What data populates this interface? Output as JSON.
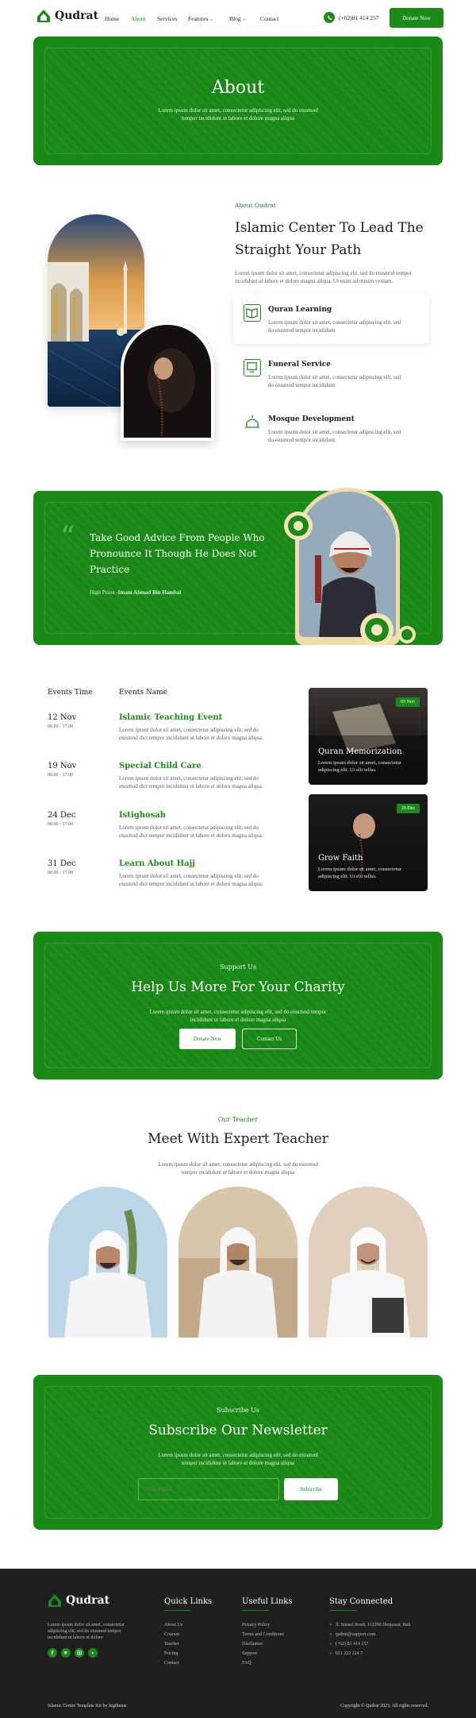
{
  "nav": {
    "brand": "Qudrat",
    "items": [
      "Home",
      "About",
      "Services",
      "Features",
      "Blog",
      "Contact"
    ],
    "phone": "(+62)81 414 257",
    "donate": "Donate Now"
  },
  "hero": {
    "title": "About",
    "desc1": "Lorem ipsum dolor sit amet, consectetur adipiscing elit, sed do eiusmod",
    "desc2": "tempor incididunt ut labore et dolore magna aliqua"
  },
  "about": {
    "eyebrow": "About Qudrat",
    "title1": "Islamic Center To Lead The",
    "title2": "Straight Your Path",
    "desc1": "Lorem ipsum dolor sit amet, consectetur adipiscing elit, sed do eiusmod tempor",
    "desc2": "incididunt ut labore et dolore magna aliqua. Ut enim ad minim veniam.",
    "features": [
      {
        "title": "Quran Learning",
        "icon": "book-icon",
        "d1": "Lorem ipsum dolor sit amet, consectetur adipiscing elit, sed",
        "d2": "do eiusmod tempor incididunt."
      },
      {
        "title": "Funeral Service",
        "icon": "funeral-icon",
        "d1": "Lorem ipsum dolor sit amet, consectetur adipiscing elit, sed",
        "d2": "do eiusmod tempor incididunt."
      },
      {
        "title": "Mosque Development",
        "icon": "mosque-icon",
        "d1": "Lorem ipsum dolor sit amet, consectetur adipiscing elit, sed",
        "d2": "do eiusmod tempor incididunt."
      }
    ]
  },
  "quote": {
    "line1": "Take Good Advice From People Who",
    "line2": "Pronounce It Though He Does Not",
    "line3": "Practice",
    "author_prefix": "High Priest -",
    "author": "Imam Ahmad Bin Hambal"
  },
  "events": {
    "col_time": "Events Time",
    "col_name": "Events Name",
    "rows": [
      {
        "date": "12 Nov",
        "time": "08.00 - 17.00",
        "title": "Islamic Teaching Event",
        "d1": "Lorem ipsum dolor sit amet, consectetur adipiscing elit, sed do",
        "d2": "eiusmod dict tempor incididunt ut labore et dolore magna aliqua."
      },
      {
        "date": "19 Nov",
        "time": "08.00 - 17.00",
        "title": "Special Child Care",
        "d1": "Lorem ipsum dolor sit amet, consectetur adipiscing elit, sed do",
        "d2": "eiusmod dict tempor incididunt ut labore et dolore magna aliqua."
      },
      {
        "date": "24 Dec",
        "time": "08.00 - 17.00",
        "title": "Istighosah",
        "d1": "Lorem ipsum dolor sit amet, consectetur adipiscing elit, sed do",
        "d2": "eiusmod dict tempor incididunt ut labore et dolore magna aliqua."
      },
      {
        "date": "31 Dec",
        "time": "08.00 - 17.00",
        "title": "Learn About Hajj",
        "d1": "Lorem ipsum dolor sit amet, consectetur adipiscing elit, sed do",
        "d2": "eiusmod dict tempor incididunt ut labore et dolore magna aliqua."
      }
    ],
    "cards": [
      {
        "badge": "05 Nov",
        "title": "Quran Memorization",
        "d1": "Lorem ipsum dolor sit amet, consectetur",
        "d2": "adipiscing elit. Ut elit tellus."
      },
      {
        "badge": "20 Dec",
        "title": "Grow Faith",
        "d1": "Lorem ipsum dolor sit amet, consectetur",
        "d2": "adipiscing elit. Ut elit tellus."
      }
    ]
  },
  "charity": {
    "eyebrow": "Support Us",
    "title": "Help Us More For Your Charity",
    "desc1": "Lorem ipsum dolor sit amet, consectetur adipiscing elit, sed do eiusmod tempor",
    "desc2": "incididunt ut labore et dolore magna aliqua",
    "btn1": "Donate Now",
    "btn2": "Contact Us"
  },
  "teacher": {
    "eyebrow": "Our Teacher",
    "title": "Meet With Expert Teacher",
    "desc1": "Lorem ipsum dolor sit amet, consectetur adipiscing elit, sed do eiusmod",
    "desc2": "tempor incididunt ut labore et dolore magna aliqua"
  },
  "newsletter": {
    "eyebrow": "Subscribe Us",
    "title": "Subscribe Our Newsletter",
    "desc1": "Lorem ipsum dolor sit amet, consectetur adipiscing elit, sed do eiusmod",
    "desc2": "tempor incididunt ut labore et dolore magna aliqua",
    "placeholder": "Your Email",
    "btn": "Subscribe"
  },
  "footer": {
    "brand": "Qudrat",
    "desc1": "Lorem ipsum dolor sit amet, consectetur",
    "desc2": "adipiscing elit, sed do eiusmod tempor",
    "desc3": "incididunt ut labore et dolore",
    "quick_title": "Quick Links",
    "quick": [
      "About Us",
      "Courses",
      "Teacher",
      "Pricing",
      "Contact"
    ],
    "useful_title": "Useful Links",
    "useful": [
      "Privacy Policy",
      "Terms and Conditions",
      "Disclaimer",
      "Support",
      "FAQ"
    ],
    "stay_title": "Stay Connected",
    "contacts": [
      "Jl. Sunset Road, 112290 Denpasar, Bali",
      "qudrat@support.com",
      "(+62) 81 414 257",
      "021 222 224 7"
    ],
    "credit": "Islamic Center Template Kit by Jegtheme",
    "copyright": "Copyright © Qudrat 2023. All rights reserved.",
    "accent": "#1c8a1a"
  }
}
